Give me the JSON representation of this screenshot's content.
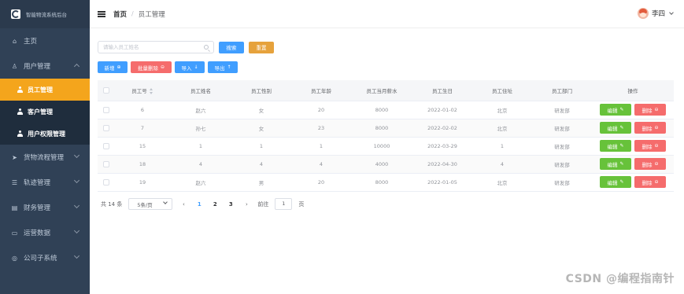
{
  "brand": {
    "title": "智能物流系统后台"
  },
  "sidebar": {
    "items": [
      {
        "label": "主页",
        "icon": "home-icon"
      },
      {
        "label": "用户管理",
        "icon": "user-icon",
        "expanded": true,
        "children": [
          {
            "label": "员工管理",
            "active": true
          },
          {
            "label": "客户管理"
          },
          {
            "label": "用户权限管理"
          }
        ]
      },
      {
        "label": "货物流程管理",
        "icon": "send-icon"
      },
      {
        "label": "轨迹管理",
        "icon": "sliders-icon"
      },
      {
        "label": "财务管理",
        "icon": "finance-icon"
      },
      {
        "label": "运营数据",
        "icon": "monitor-icon"
      },
      {
        "label": "公司子系统",
        "icon": "chat-icon"
      }
    ]
  },
  "header": {
    "breadcrumb_home": "首页",
    "breadcrumb_separator": "/",
    "breadcrumb_current": "员工管理",
    "username": "李四"
  },
  "search": {
    "placeholder": "请输入员工姓名",
    "search_label": "搜索",
    "reset_label": "重置"
  },
  "toolbar": {
    "add_label": "新增",
    "batch_delete_label": "批量删除",
    "import_label": "导入",
    "export_label": "导出"
  },
  "table": {
    "columns": [
      "员工号",
      "员工姓名",
      "员工性别",
      "员工年龄",
      "员工当月薪水",
      "员工生日",
      "员工住址",
      "员工部门",
      "操作"
    ],
    "rows": [
      [
        "6",
        "赵六",
        "女",
        "20",
        "8000",
        "2022-01-02",
        "北京",
        "研发部"
      ],
      [
        "7",
        "孙七",
        "女",
        "23",
        "8000",
        "2022-02-02",
        "北京",
        "研发部"
      ],
      [
        "15",
        "1",
        "1",
        "1",
        "10000",
        "2022-03-29",
        "1",
        "研发部"
      ],
      [
        "18",
        "4",
        "4",
        "4",
        "4000",
        "2022-04-30",
        "4",
        "研发部"
      ],
      [
        "19",
        "赵六",
        "男",
        "20",
        "8000",
        "2022-01-05",
        "北京",
        "研发部"
      ]
    ],
    "edit_label": "编辑",
    "delete_label": "删除"
  },
  "pagination": {
    "total_text": "共 14 条",
    "page_size": "5条/页",
    "pages": [
      "1",
      "2",
      "3"
    ],
    "current_page": "1",
    "goto_label": "前往",
    "goto_value": "1",
    "page_unit": "页"
  },
  "watermark": "CSDN @编程指南针",
  "colors": {
    "sidebar_bg": "#304156",
    "active_menu": "#f4a51c",
    "primary": "#409eff",
    "warning": "#e6a23c",
    "danger": "#f56c6c",
    "success": "#67c23a"
  }
}
